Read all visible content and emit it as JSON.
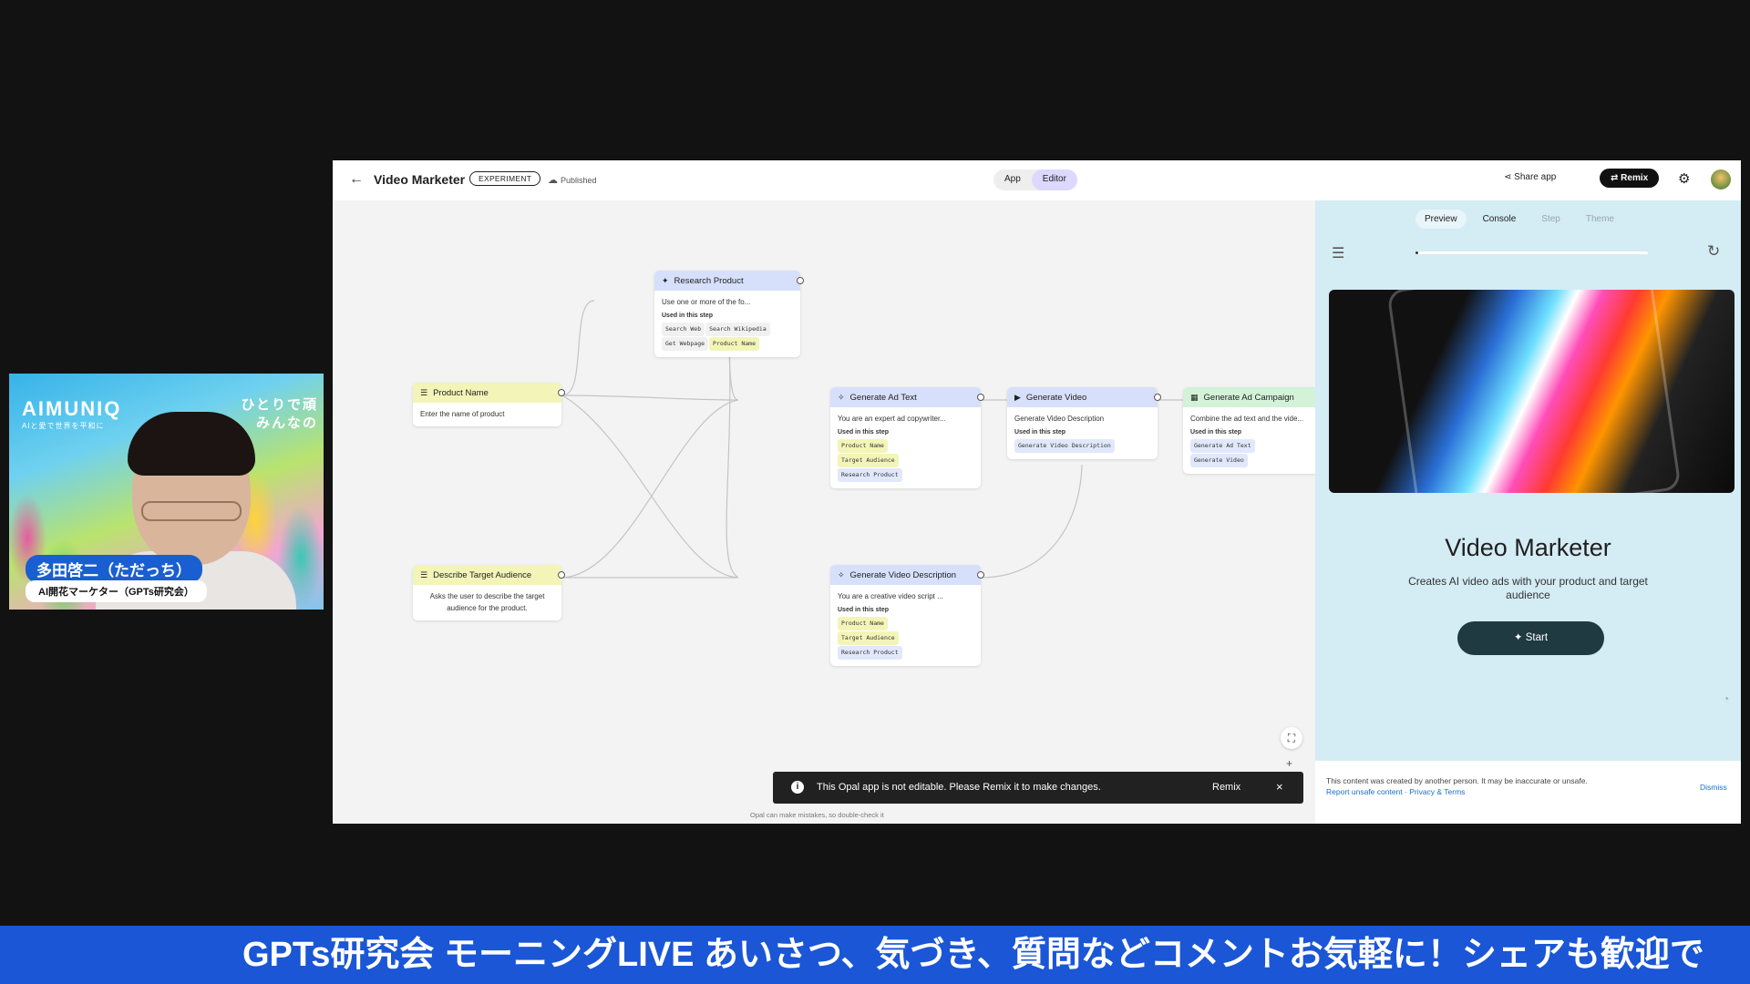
{
  "webcam": {
    "brand": "AIMUNIQ",
    "brand_sub": "AIと愛で世界を平和に",
    "tagline_line1": "ひとりで頑",
    "tagline_line2": "みんなの",
    "name": "多田啓二（ただっち）",
    "title": "AI開花マーケター（GPTs研究会）"
  },
  "header": {
    "title": "Video Marketer",
    "badge": "EXPERIMENT",
    "status": "Published",
    "modes": [
      "App",
      "Editor"
    ],
    "active_mode": "Editor",
    "share": "Share app",
    "remix": "Remix"
  },
  "nodes": {
    "research": {
      "title": "Research Product",
      "desc": "Use one or more of the fo...",
      "used": "Used in this step",
      "chips": [
        "Search Web",
        "Search Wikipedia",
        "Get Webpage",
        "Product Name"
      ]
    },
    "product_name": {
      "title": "Product Name",
      "desc": "Enter the name of product"
    },
    "ad_text": {
      "title": "Generate Ad Text",
      "desc": "You are an expert ad copywriter...",
      "used": "Used in this step",
      "chips": [
        "Product Name",
        "Target Audience",
        "Research Product"
      ]
    },
    "video": {
      "title": "Generate Video",
      "desc": "Generate Video Description",
      "used": "Used in this step",
      "chips": [
        "Generate Video Description"
      ]
    },
    "campaign": {
      "title": "Generate Ad Campaign",
      "desc": "Combine the ad text and the vide...",
      "used": "Used in this step",
      "chips": [
        "Generate Ad Text",
        "Generate Video"
      ]
    },
    "audience": {
      "title": "Describe Target Audience",
      "desc_line1": "Asks the user to describe the target",
      "desc_line2": "audience for the product."
    },
    "video_desc": {
      "title": "Generate Video Description",
      "desc": "You are a creative video script ...",
      "used": "Used in this step",
      "chips": [
        "Product Name",
        "Target Audience",
        "Research Product"
      ]
    }
  },
  "toast": {
    "message": "This Opal app is not editable. Please Remix it to make changes.",
    "action": "Remix",
    "close": "×"
  },
  "disclaimer": "Opal can make mistakes, so double-check it",
  "panel": {
    "tabs": [
      "Preview",
      "Console",
      "Step",
      "Theme"
    ],
    "active_tab": "Preview",
    "progress": 0.01,
    "title": "Video Marketer",
    "description": "Creates AI video ads with your product and target audience",
    "start": "Start",
    "footer_line1": "This content was created by another person. It may be inaccurate or unsafe.",
    "footer_links": "Report unsafe content · Privacy & Terms",
    "dismiss": "Dismiss"
  },
  "ticker": "GPTs研究会 モーニングLIVE あいさつ、気づき、質問などコメントお気軽に！シェアも歓迎で",
  "colors": {
    "accent_purple": "#dcd8ff",
    "node_yellow": "#f3f5b8",
    "node_blue": "#d6e0fb",
    "node_green": "#d3f2d8",
    "panel_bg": "#d4ecf4",
    "start_btn": "#1f3a40",
    "ticker_bg": "#1a56d6"
  },
  "icons": [
    "back-arrow-icon",
    "cloud-icon",
    "share-icon",
    "remix-icon",
    "gear-icon",
    "sparkle-icon",
    "list-icon",
    "video-icon",
    "table-icon",
    "hamburger-icon",
    "reload-icon",
    "info-icon",
    "close-icon",
    "fit-view-icon",
    "plus-icon"
  ]
}
